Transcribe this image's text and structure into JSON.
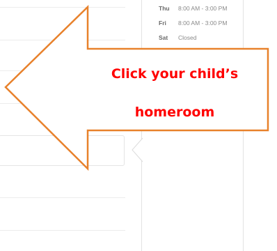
{
  "hours": [
    {
      "day": "Thu",
      "time": "8:00 AM - 3:00 PM"
    },
    {
      "day": "Fri",
      "time": "8:00 AM - 3:00 PM"
    },
    {
      "day": "Sat",
      "time": "Closed"
    }
  ],
  "callout": {
    "line1": "Click your child’s",
    "line2": "homeroom",
    "text_color": "#ff0000",
    "arrow_outline_color": "#e8812b",
    "icon": "left-arrow-icon"
  }
}
